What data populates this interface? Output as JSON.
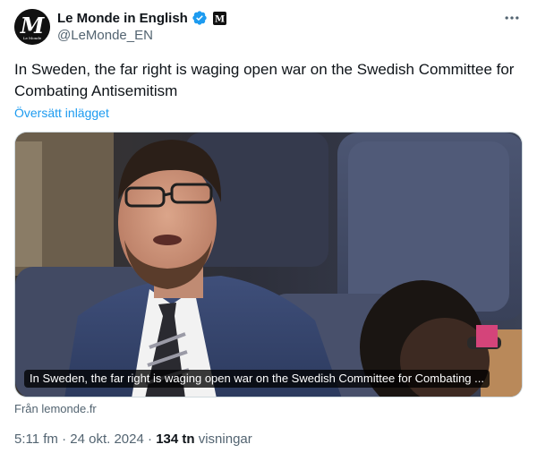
{
  "author": {
    "display_name": "Le Monde in English",
    "handle": "@LeMonde_EN",
    "avatar_letter": "M",
    "avatar_caption": "Le Monde",
    "verified_color": "#1d9bf0",
    "verified_icon": "verified-badge-icon",
    "affiliate_icon": "le-monde-affiliate-badge-icon"
  },
  "more_icon": "more-horizontal-icon",
  "tweet": {
    "text": "In Sweden, the far right is waging open war on the Swedish Committee for Combating Antisemitism",
    "translate_label": "Översätt inlägget"
  },
  "card": {
    "caption": "In Sweden, the far right is waging open war on the Swedish Committee for Combating ...",
    "source": "Från lemonde.fr"
  },
  "meta": {
    "time": "5:11 fm",
    "separator": "·",
    "date": "24 okt. 2024",
    "views_count": "134 tn",
    "views_label": "visningar"
  },
  "colors": {
    "link": "#1d9bf0",
    "secondary_text": "#536471",
    "primary_text": "#0f1419"
  }
}
